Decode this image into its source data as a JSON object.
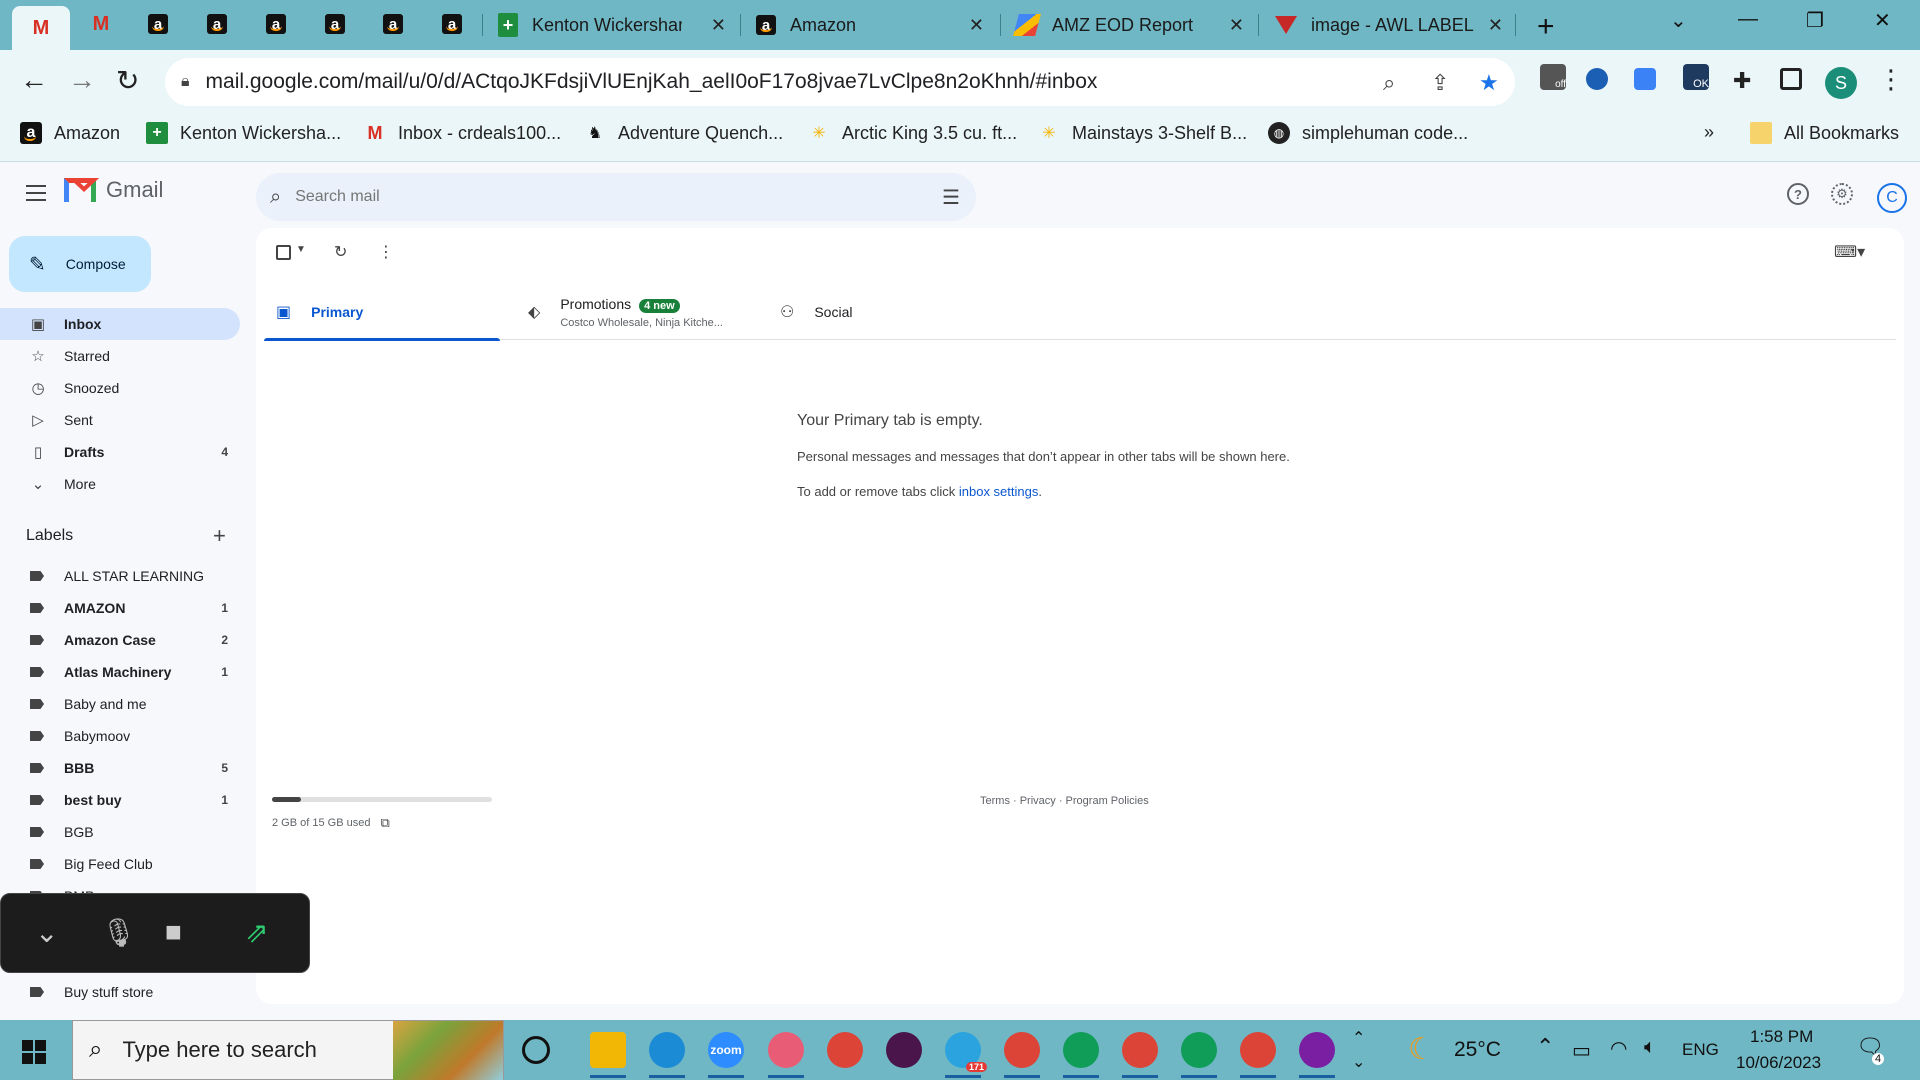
{
  "browser": {
    "tabs": [
      {
        "title": "Kenton Wickersham",
        "favicon": "sheets-icon"
      },
      {
        "title": "Amazon",
        "favicon": "amazon-icon"
      },
      {
        "title": "AMZ EOD Report",
        "favicon": "eod-icon"
      },
      {
        "title": "image - AWL LABEL",
        "favicon": "awl-icon"
      }
    ],
    "url": "mail.google.com/mail/u/0/d/ACtqoJKFdsjiVlUEnjKah_aelI0oF17o8jvae7LvClpe8n2oKhnh/#inbox",
    "profile_initial": "S",
    "ext_off": "off",
    "ext_ok": "OK",
    "bookmarks": [
      {
        "label": "Amazon"
      },
      {
        "label": "Kenton Wickersha..."
      },
      {
        "label": "Inbox - crdeals100..."
      },
      {
        "label": "Adventure Quench..."
      },
      {
        "label": "Arctic King 3.5 cu. ft..."
      },
      {
        "label": "Mainstays 3-Shelf B..."
      },
      {
        "label": "simplehuman code..."
      }
    ],
    "bookmarks_more": "»",
    "all_bookmarks": "All Bookmarks"
  },
  "gmail": {
    "brand": "Gmail",
    "search_placeholder": "Search mail",
    "account_initial": "C",
    "compose": "Compose",
    "nav": [
      {
        "label": "Inbox",
        "count": ""
      },
      {
        "label": "Starred",
        "count": ""
      },
      {
        "label": "Snoozed",
        "count": ""
      },
      {
        "label": "Sent",
        "count": ""
      },
      {
        "label": "Drafts",
        "count": "4"
      },
      {
        "label": "More",
        "count": ""
      }
    ],
    "labels_title": "Labels",
    "labels": [
      {
        "label": "ALL STAR LEARNING",
        "count": ""
      },
      {
        "label": "AMAZON",
        "count": "1"
      },
      {
        "label": "Amazon Case",
        "count": "2"
      },
      {
        "label": "Atlas Machinery",
        "count": "1"
      },
      {
        "label": "Baby and me",
        "count": ""
      },
      {
        "label": "Babymoov",
        "count": ""
      },
      {
        "label": "BBB",
        "count": "5"
      },
      {
        "label": "best buy",
        "count": "1"
      },
      {
        "label": "BGB",
        "count": ""
      },
      {
        "label": "Big Feed Club",
        "count": ""
      },
      {
        "label": "BMP",
        "count": ""
      },
      {
        "label": "Buy stuff store",
        "count": ""
      }
    ],
    "tabs": {
      "primary": "Primary",
      "promotions": "Promotions",
      "promotions_badge": "4 new",
      "promotions_sub": "Costco Wholesale, Ninja Kitche...",
      "social": "Social"
    },
    "empty": {
      "title": "Your Primary tab is empty.",
      "line1": "Personal messages and messages that don’t appear in other tabs will be shown here.",
      "line2_prefix": "To add or remove tabs click ",
      "line2_link": "inbox settings",
      "line2_suffix": "."
    },
    "storage": {
      "text": "2 GB of 15 GB used",
      "fraction": 0.133
    },
    "footer": "Terms · Privacy · Program Policies"
  },
  "taskbar": {
    "search_placeholder": "Type here to search",
    "weather": "25°C",
    "lang": "ENG",
    "time": "1:58 PM",
    "date": "10/06/2023",
    "notifications": "4",
    "telegram_badge": "171",
    "zoom_label": "zoom"
  }
}
